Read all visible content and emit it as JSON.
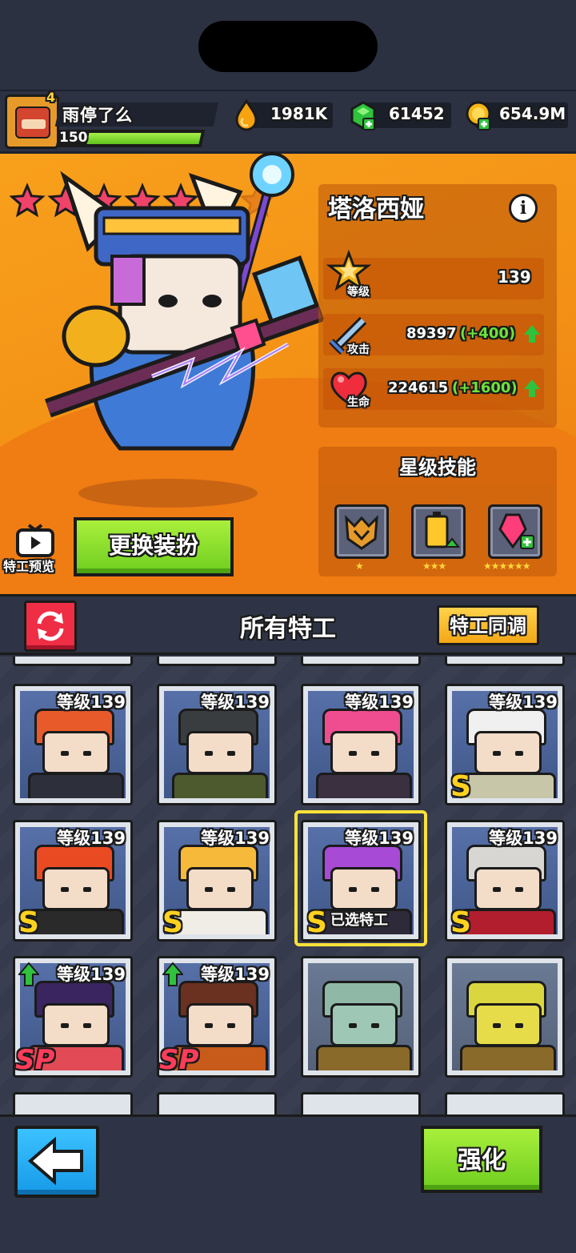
{
  "player": {
    "name": "雨停了么",
    "level": "150",
    "badge": "4"
  },
  "resources": {
    "energy": "1981K",
    "gems": "61452",
    "gold": "654.9M"
  },
  "hero": {
    "name": "塔洛西娅",
    "stars_filled": 5,
    "stars_total": 7,
    "level_label": "等级",
    "level_value": "139",
    "attack_label": "攻击",
    "attack_value": "89397",
    "attack_bonus": "(+400)",
    "hp_label": "生命",
    "hp_value": "224615",
    "hp_bonus": "(+1600)"
  },
  "star_skills": {
    "title": "星级技能",
    "skills": [
      {
        "icon": "helmet-icon",
        "stars": "★"
      },
      {
        "icon": "battery-icon",
        "stars": "★★★"
      },
      {
        "icon": "crystal-icon",
        "stars": "★★★★★★"
      }
    ]
  },
  "preview_label": "特工预览",
  "outfit_button": "更换装扮",
  "agents": {
    "title": "所有特工",
    "sync_button": "特工同调",
    "selected_label": "已选特工",
    "cards": [
      {
        "level": "等级139",
        "rank": "",
        "hair": "#e95a2a",
        "body": "#2d2f3a",
        "up": false
      },
      {
        "level": "等级139",
        "rank": "",
        "hair": "#3a3d3f",
        "body": "#4d5a2d",
        "up": false
      },
      {
        "level": "等级139",
        "rank": "",
        "hair": "#ef4d8f",
        "body": "#3a3040",
        "up": false
      },
      {
        "level": "等级139",
        "rank": "S",
        "hair": "#f0f0f0",
        "body": "#c8c6a8",
        "up": false
      },
      {
        "level": "等级139",
        "rank": "S",
        "hair": "#ea4a22",
        "body": "#2a2a2a",
        "up": false
      },
      {
        "level": "等级139",
        "rank": "S",
        "hair": "#f6b93a",
        "body": "#f0ede6",
        "up": false
      },
      {
        "level": "等级139",
        "rank": "S",
        "hair": "#a74bd6",
        "body": "#2f2a3a",
        "up": false,
        "selected": true
      },
      {
        "level": "等级139",
        "rank": "S",
        "hair": "#d8d6d2",
        "body": "#b21e2e",
        "up": false
      },
      {
        "level": "等级139",
        "rank": "SP",
        "hair": "#3a2560",
        "body": "#e24b55",
        "up": true
      },
      {
        "level": "等级139",
        "rank": "SP",
        "hair": "#6a3020",
        "body": "#c85a1a",
        "up": true
      },
      {
        "level": "",
        "rank": "",
        "hair": "#8fb8a6",
        "body": "#8a6a2a",
        "up": false,
        "plain": true
      },
      {
        "level": "",
        "rank": "",
        "hair": "#d9d640",
        "body": "#8a6a2a",
        "up": false,
        "plain": true
      }
    ]
  },
  "footer": {
    "upgrade_button": "强化"
  },
  "colors": {
    "accent_green": "#6fce1f",
    "accent_orange": "#f39015",
    "select_yellow": "#ffe23a"
  }
}
